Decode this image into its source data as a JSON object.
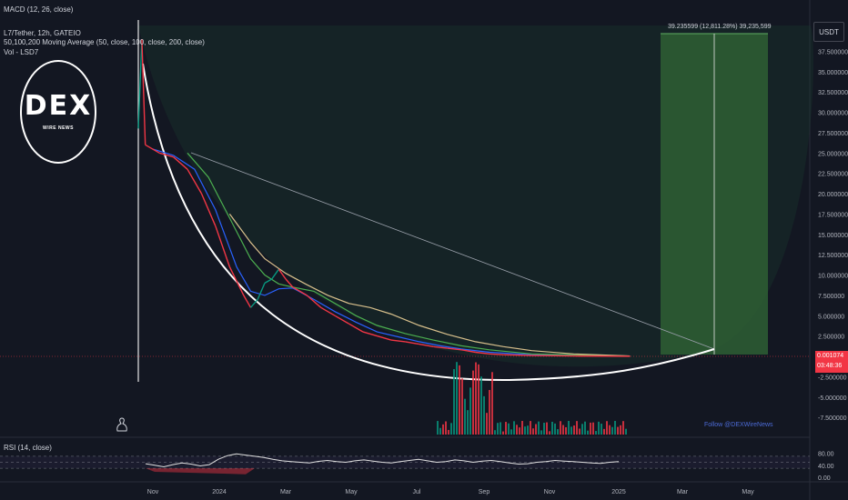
{
  "chart_data": {
    "type": "line",
    "symbol": "L7/Tether, 12h, GATEIO",
    "indicators": {
      "macd": "MACD (12, 26, close)",
      "ma": "50,100,200 Moving Average (50, close, 100, close, 200, close)",
      "vol": "Vol - LSD7",
      "rsi": "RSI (14, close)"
    },
    "price_axis": {
      "label": "USDT",
      "ticks": [
        "37.500000",
        "35.000000",
        "32.500000",
        "30.000000",
        "27.500000",
        "25.000000",
        "22.500000",
        "20.000000",
        "17.500000",
        "15.000000",
        "12.500000",
        "10.000000",
        "7.500000",
        "5.000000",
        "2.500000",
        "0.000000",
        "-2.500000",
        "-5.000000",
        "-7.500000"
      ],
      "ylim": [
        -7.5,
        37.5
      ]
    },
    "rsi_axis": {
      "ticks": [
        "80.00",
        "40.00",
        "0.00"
      ]
    },
    "time_axis": [
      "Nov",
      "2024",
      "Mar",
      "May",
      "Jul",
      "Sep",
      "Nov",
      "2025",
      "Mar",
      "May"
    ],
    "price_series": {
      "name": "L7/Tether",
      "points": [
        [
          0,
          28
        ],
        [
          0.5,
          39
        ],
        [
          1,
          26
        ],
        [
          3,
          25
        ],
        [
          5,
          24.5
        ],
        [
          7,
          23
        ],
        [
          9,
          20
        ],
        [
          11,
          16
        ],
        [
          13,
          11
        ],
        [
          15,
          7.5
        ],
        [
          16,
          6
        ],
        [
          17,
          7
        ],
        [
          18,
          9
        ],
        [
          19,
          9.5
        ],
        [
          20,
          10.7
        ],
        [
          21,
          9.5
        ],
        [
          22,
          8.5
        ],
        [
          24,
          7.5
        ],
        [
          26,
          6
        ],
        [
          28,
          5
        ],
        [
          30,
          4
        ],
        [
          32,
          3
        ],
        [
          34,
          2.5
        ],
        [
          36,
          2
        ],
        [
          38,
          1.8
        ],
        [
          40,
          1.5
        ],
        [
          42,
          1.2
        ],
        [
          44,
          1
        ],
        [
          46,
          0.8
        ],
        [
          48,
          0.5
        ],
        [
          50,
          0.3
        ],
        [
          52,
          0.2
        ],
        [
          56,
          0.1
        ],
        [
          62,
          0.05
        ],
        [
          70,
          0.01
        ]
      ]
    },
    "moving_averages": [
      {
        "period": 50,
        "color": "#2962ff",
        "points": [
          [
            2,
            25.5
          ],
          [
            5,
            24.7
          ],
          [
            8,
            23
          ],
          [
            11,
            18
          ],
          [
            14,
            11
          ],
          [
            16,
            8
          ],
          [
            18,
            7.5
          ],
          [
            20,
            8.3
          ],
          [
            22,
            8.4
          ],
          [
            25,
            7
          ],
          [
            28,
            5.5
          ],
          [
            31,
            4.2
          ],
          [
            34,
            3
          ],
          [
            37,
            2.4
          ],
          [
            40,
            1.8
          ],
          [
            43,
            1.3
          ],
          [
            46,
            0.9
          ],
          [
            50,
            0.5
          ],
          [
            56,
            0.2
          ],
          [
            70,
            0.05
          ]
        ]
      },
      {
        "period": 100,
        "color": "#4caf50",
        "points": [
          [
            7,
            25
          ],
          [
            10,
            22
          ],
          [
            13,
            17
          ],
          [
            16,
            12
          ],
          [
            18,
            10
          ],
          [
            20,
            8.9
          ],
          [
            22,
            8.5
          ],
          [
            25,
            8
          ],
          [
            28,
            6.5
          ],
          [
            31,
            5
          ],
          [
            34,
            3.8
          ],
          [
            38,
            2.8
          ],
          [
            42,
            2
          ],
          [
            46,
            1.3
          ],
          [
            50,
            0.8
          ],
          [
            56,
            0.3
          ],
          [
            70,
            0.05
          ]
        ]
      },
      {
        "period": 200,
        "color": "#d8c08c",
        "points": [
          [
            13,
            17.5
          ],
          [
            16,
            14
          ],
          [
            18,
            12
          ],
          [
            21,
            10.2
          ],
          [
            24,
            8.8
          ],
          [
            27,
            7.5
          ],
          [
            30,
            6.5
          ],
          [
            33,
            6
          ],
          [
            36,
            5.2
          ],
          [
            40,
            3.8
          ],
          [
            44,
            2.7
          ],
          [
            48,
            1.8
          ],
          [
            52,
            1.2
          ],
          [
            56,
            0.7
          ],
          [
            62,
            0.3
          ],
          [
            70,
            0.05
          ]
        ]
      }
    ],
    "measure_label": "39.235599 (12,811.28%) 39,235,599",
    "current_price": "0.001074",
    "countdown": "03:48:36",
    "rsi_series": [
      45,
      40,
      35,
      42,
      48,
      44,
      38,
      42,
      60,
      72,
      78,
      74,
      70,
      66,
      60,
      55,
      52,
      50,
      48,
      53,
      56,
      52,
      50,
      55,
      58,
      54,
      50,
      48,
      52,
      56,
      60,
      55,
      50,
      52,
      58,
      55,
      50,
      54,
      56,
      52,
      48,
      44,
      45,
      50,
      52,
      56,
      54,
      52,
      50,
      48,
      46,
      50,
      52
    ]
  },
  "watermark": {
    "brand": "DEX",
    "sub": "WIRE NEWS"
  },
  "follow_text": "Follow @DEXWireNews",
  "colors": {
    "up": "#089981",
    "down": "#f23645",
    "bg": "#131722"
  }
}
